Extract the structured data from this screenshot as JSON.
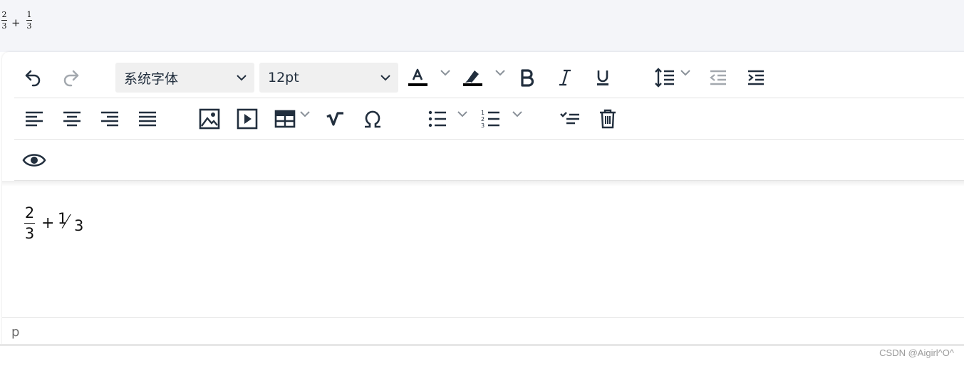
{
  "preview": {
    "frac1_num": "2",
    "frac1_den": "3",
    "plus": "+",
    "frac2_num": "1",
    "frac2_den": "3"
  },
  "toolbar": {
    "font_family": "系统字体",
    "font_size": "12pt",
    "text_color": "#000000",
    "highlight_color": "#000000",
    "icons_row1": [
      "undo-icon",
      "redo-icon",
      "text-color-icon",
      "highlight-icon",
      "bold-icon",
      "italic-icon",
      "underline-icon",
      "line-height-icon",
      "outdent-icon",
      "indent-icon"
    ],
    "icons_row2": [
      "align-left-icon",
      "align-center-icon",
      "align-right-icon",
      "align-justify-icon",
      "image-icon",
      "media-icon",
      "table-icon",
      "formula-icon",
      "special-char-icon",
      "bullet-list-icon",
      "numbered-list-icon",
      "checklist-icon",
      "delete-icon"
    ],
    "icons_row3": [
      "preview-icon"
    ]
  },
  "content": {
    "frac1_num": "2",
    "frac1_den": "3",
    "plus": "+",
    "frac2_num": "1",
    "frac2_slash": "⁄",
    "frac2_den": "3"
  },
  "statusbar": {
    "path": "p"
  },
  "watermark": "CSDN @Aigirl^O^"
}
